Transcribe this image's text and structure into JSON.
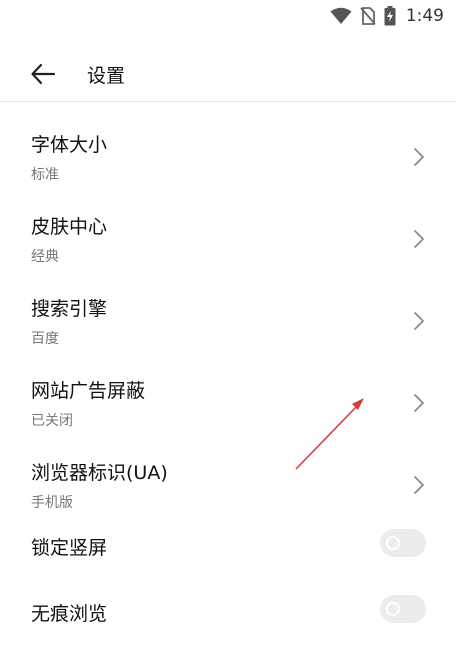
{
  "status": {
    "time": "1:49"
  },
  "header": {
    "title": "设置"
  },
  "items": [
    {
      "label": "字体大小",
      "sub": "标准"
    },
    {
      "label": "皮肤中心",
      "sub": "经典"
    },
    {
      "label": "搜索引擎",
      "sub": "百度"
    },
    {
      "label": "网站广告屏蔽",
      "sub": "已关闭"
    },
    {
      "label": "浏览器标识(UA)",
      "sub": "手机版"
    }
  ],
  "toggles": [
    {
      "label": "锁定竖屏",
      "on": false
    },
    {
      "label": "无痕浏览",
      "on": false
    }
  ],
  "colors": {
    "annotation_arrow": "#d63a3a",
    "toggle_off": "#ececec"
  }
}
